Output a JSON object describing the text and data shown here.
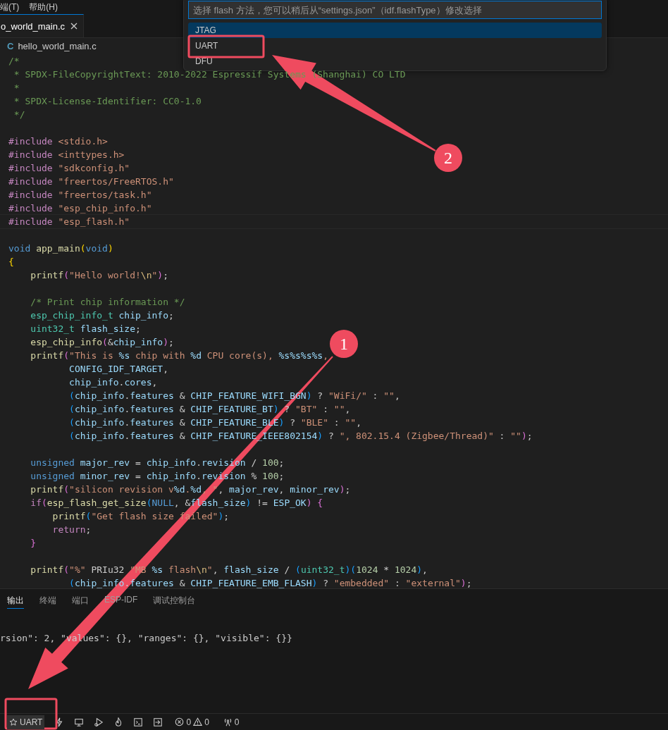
{
  "menu_bar": {
    "items": [
      "端(T)",
      "帮助(H)"
    ]
  },
  "editor_tabs": [
    {
      "label": "o_world_main.c",
      "selected": true
    }
  ],
  "breadcrumb": {
    "file_type": "C",
    "file": "hello_world_main.c"
  },
  "code": {
    "lines": [
      {
        "kind": "code",
        "tokens": [
          {
            "kind": "c",
            "text": "/*"
          }
        ]
      },
      {
        "kind": "code",
        "tokens": [
          {
            "kind": "c",
            "text": " * SPDX-FileCopyrightText: 2010-2022 Espressif Systems (Shanghai) CO LTD"
          }
        ]
      },
      {
        "kind": "code",
        "tokens": [
          {
            "kind": "c",
            "text": " *"
          }
        ]
      },
      {
        "kind": "code",
        "tokens": [
          {
            "kind": "c",
            "text": " * SPDX-License-Identifier: CC0-1.0"
          }
        ]
      },
      {
        "kind": "code",
        "tokens": [
          {
            "kind": "c",
            "text": " */"
          }
        ]
      },
      {
        "kind": "blank"
      },
      {
        "kind": "code",
        "tokens": [
          {
            "kind": "p",
            "text": "#include"
          },
          {
            "kind": "s",
            "text": " <stdio.h>"
          }
        ]
      },
      {
        "kind": "code",
        "tokens": [
          {
            "kind": "p",
            "text": "#include"
          },
          {
            "kind": "s",
            "text": " <inttypes.h>"
          }
        ]
      },
      {
        "kind": "code",
        "tokens": [
          {
            "kind": "p",
            "text": "#include"
          },
          {
            "kind": "s",
            "text": " \"sdkconfig.h\""
          }
        ]
      },
      {
        "kind": "code",
        "tokens": [
          {
            "kind": "p",
            "text": "#include"
          },
          {
            "kind": "s",
            "text": " \"freertos/FreeRTOS.h\""
          }
        ]
      },
      {
        "kind": "code",
        "tokens": [
          {
            "kind": "p",
            "text": "#include"
          },
          {
            "kind": "s",
            "text": " \"freertos/task.h\""
          }
        ]
      },
      {
        "kind": "code",
        "tokens": [
          {
            "kind": "p",
            "text": "#include"
          },
          {
            "kind": "s",
            "text": " \"esp_chip_info.h\""
          }
        ]
      },
      {
        "kind": "code",
        "current": true,
        "tokens": [
          {
            "kind": "p",
            "text": "#include"
          },
          {
            "kind": "s",
            "text": " \"esp_flash.h\""
          }
        ]
      },
      {
        "kind": "blank"
      },
      {
        "kind": "code",
        "tokens": [
          {
            "kind": "k",
            "text": "void"
          },
          {
            "kind": "f",
            "text": " app_main"
          },
          {
            "kind": "b1",
            "text": "("
          },
          {
            "kind": "k",
            "text": "void"
          },
          {
            "kind": "b1",
            "text": ")"
          }
        ]
      },
      {
        "kind": "code",
        "tokens": [
          {
            "kind": "b1",
            "text": "{"
          }
        ]
      },
      {
        "kind": "code",
        "tokens": [
          {
            "kind": "f",
            "text": "    printf"
          },
          {
            "kind": "b2",
            "text": "("
          },
          {
            "kind": "s",
            "text": "\"Hello world!"
          },
          {
            "kind": "e",
            "text": "\\n"
          },
          {
            "kind": "s",
            "text": "\""
          },
          {
            "kind": "b2",
            "text": ")"
          },
          {
            "kind": "x",
            "text": ";"
          }
        ]
      },
      {
        "kind": "blank"
      },
      {
        "kind": "code",
        "tokens": [
          {
            "kind": "c",
            "text": "    /* Print chip information */"
          }
        ]
      },
      {
        "kind": "code",
        "tokens": [
          {
            "kind": "t",
            "text": "    esp_chip_info_t"
          },
          {
            "kind": "v",
            "text": " chip_info"
          },
          {
            "kind": "x",
            "text": ";"
          }
        ]
      },
      {
        "kind": "code",
        "tokens": [
          {
            "kind": "t",
            "text": "    uint32_t"
          },
          {
            "kind": "v",
            "text": " flash_size"
          },
          {
            "kind": "x",
            "text": ";"
          }
        ]
      },
      {
        "kind": "code",
        "tokens": [
          {
            "kind": "f",
            "text": "    esp_chip_info"
          },
          {
            "kind": "b2",
            "text": "("
          },
          {
            "kind": "x",
            "text": "&"
          },
          {
            "kind": "v",
            "text": "chip_info"
          },
          {
            "kind": "b2",
            "text": ")"
          },
          {
            "kind": "x",
            "text": ";"
          }
        ]
      },
      {
        "kind": "code",
        "tokens": [
          {
            "kind": "f",
            "text": "    printf"
          },
          {
            "kind": "b2",
            "text": "("
          },
          {
            "kind": "s",
            "text": "\"This is "
          },
          {
            "kind": "v",
            "text": "%s"
          },
          {
            "kind": "s",
            "text": " chip with "
          },
          {
            "kind": "v",
            "text": "%d"
          },
          {
            "kind": "s",
            "text": " CPU core(s), "
          },
          {
            "kind": "v",
            "text": "%s%s%s%s"
          },
          {
            "kind": "s",
            "text": ","
          }
        ]
      },
      {
        "kind": "code",
        "tokens": [
          {
            "kind": "v",
            "text": "           CONFIG_IDF_TARGET"
          },
          {
            "kind": "x",
            "text": ","
          }
        ]
      },
      {
        "kind": "code",
        "tokens": [
          {
            "kind": "v",
            "text": "           chip_info"
          },
          {
            "kind": "x",
            "text": "."
          },
          {
            "kind": "v",
            "text": "cores"
          },
          {
            "kind": "x",
            "text": ","
          }
        ]
      },
      {
        "kind": "code",
        "tokens": [
          {
            "kind": "b3",
            "text": "           ("
          },
          {
            "kind": "v",
            "text": "chip_info"
          },
          {
            "kind": "x",
            "text": "."
          },
          {
            "kind": "v",
            "text": "features"
          },
          {
            "kind": "x",
            "text": " & "
          },
          {
            "kind": "v",
            "text": "CHIP_FEATURE_WIFI_BGN"
          },
          {
            "kind": "b3",
            "text": ")"
          },
          {
            "kind": "x",
            "text": " ? "
          },
          {
            "kind": "s",
            "text": "\"WiFi/\""
          },
          {
            "kind": "x",
            "text": " : "
          },
          {
            "kind": "s",
            "text": "\"\""
          },
          {
            "kind": "x",
            "text": ","
          }
        ]
      },
      {
        "kind": "code",
        "tokens": [
          {
            "kind": "b3",
            "text": "           ("
          },
          {
            "kind": "v",
            "text": "chip_info"
          },
          {
            "kind": "x",
            "text": "."
          },
          {
            "kind": "v",
            "text": "features"
          },
          {
            "kind": "x",
            "text": " & "
          },
          {
            "kind": "v",
            "text": "CHIP_FEATURE_BT"
          },
          {
            "kind": "b3",
            "text": ")"
          },
          {
            "kind": "x",
            "text": " ? "
          },
          {
            "kind": "s",
            "text": "\"BT\""
          },
          {
            "kind": "x",
            "text": " : "
          },
          {
            "kind": "s",
            "text": "\"\""
          },
          {
            "kind": "x",
            "text": ","
          }
        ]
      },
      {
        "kind": "code",
        "tokens": [
          {
            "kind": "b3",
            "text": "           ("
          },
          {
            "kind": "v",
            "text": "chip_info"
          },
          {
            "kind": "x",
            "text": "."
          },
          {
            "kind": "v",
            "text": "features"
          },
          {
            "kind": "x",
            "text": " & "
          },
          {
            "kind": "v",
            "text": "CHIP_FEATURE_BLE"
          },
          {
            "kind": "b3",
            "text": ")"
          },
          {
            "kind": "x",
            "text": " ? "
          },
          {
            "kind": "s",
            "text": "\"BLE\""
          },
          {
            "kind": "x",
            "text": " : "
          },
          {
            "kind": "s",
            "text": "\"\""
          },
          {
            "kind": "x",
            "text": ","
          }
        ]
      },
      {
        "kind": "code",
        "tokens": [
          {
            "kind": "b3",
            "text": "           ("
          },
          {
            "kind": "v",
            "text": "chip_info"
          },
          {
            "kind": "x",
            "text": "."
          },
          {
            "kind": "v",
            "text": "features"
          },
          {
            "kind": "x",
            "text": " & "
          },
          {
            "kind": "v",
            "text": "CHIP_FEATURE_IEEE802154"
          },
          {
            "kind": "b3",
            "text": ")"
          },
          {
            "kind": "x",
            "text": " ? "
          },
          {
            "kind": "s",
            "text": "\", 802.15.4 (Zigbee/Thread)\""
          },
          {
            "kind": "x",
            "text": " : "
          },
          {
            "kind": "s",
            "text": "\"\""
          },
          {
            "kind": "b2",
            "text": ")"
          },
          {
            "kind": "x",
            "text": ";"
          }
        ]
      },
      {
        "kind": "blank"
      },
      {
        "kind": "code",
        "tokens": [
          {
            "kind": "k",
            "text": "    unsigned"
          },
          {
            "kind": "v",
            "text": " major_rev"
          },
          {
            "kind": "x",
            "text": " = "
          },
          {
            "kind": "v",
            "text": "chip_info"
          },
          {
            "kind": "x",
            "text": "."
          },
          {
            "kind": "v",
            "text": "revision"
          },
          {
            "kind": "x",
            "text": " / "
          },
          {
            "kind": "n",
            "text": "100"
          },
          {
            "kind": "x",
            "text": ";"
          }
        ]
      },
      {
        "kind": "code",
        "tokens": [
          {
            "kind": "k",
            "text": "    unsigned"
          },
          {
            "kind": "v",
            "text": " minor_rev"
          },
          {
            "kind": "x",
            "text": " = "
          },
          {
            "kind": "v",
            "text": "chip_info"
          },
          {
            "kind": "x",
            "text": "."
          },
          {
            "kind": "v",
            "text": "revision"
          },
          {
            "kind": "x",
            "text": " % "
          },
          {
            "kind": "n",
            "text": "100"
          },
          {
            "kind": "x",
            "text": ";"
          }
        ]
      },
      {
        "kind": "code",
        "tokens": [
          {
            "kind": "f",
            "text": "    printf"
          },
          {
            "kind": "b2",
            "text": "("
          },
          {
            "kind": "s",
            "text": "\"silicon revision v"
          },
          {
            "kind": "v",
            "text": "%d"
          },
          {
            "kind": "s",
            "text": "."
          },
          {
            "kind": "v",
            "text": "%d"
          },
          {
            "kind": "s",
            "text": ", \""
          },
          {
            "kind": "x",
            "text": ", "
          },
          {
            "kind": "v",
            "text": "major_rev"
          },
          {
            "kind": "x",
            "text": ", "
          },
          {
            "kind": "v",
            "text": "minor_rev"
          },
          {
            "kind": "b2",
            "text": ")"
          },
          {
            "kind": "x",
            "text": ";"
          }
        ]
      },
      {
        "kind": "code",
        "tokens": [
          {
            "kind": "p",
            "text": "    if"
          },
          {
            "kind": "b2",
            "text": "("
          },
          {
            "kind": "f",
            "text": "esp_flash_get_size"
          },
          {
            "kind": "b3",
            "text": "("
          },
          {
            "kind": "k",
            "text": "NULL"
          },
          {
            "kind": "x",
            "text": ", &"
          },
          {
            "kind": "v",
            "text": "flash_size"
          },
          {
            "kind": "b3",
            "text": ")"
          },
          {
            "kind": "x",
            "text": " != "
          },
          {
            "kind": "v",
            "text": "ESP_OK"
          },
          {
            "kind": "b2",
            "text": ")"
          },
          {
            "kind": "b2",
            "text": " {"
          }
        ]
      },
      {
        "kind": "code",
        "tokens": [
          {
            "kind": "f",
            "text": "        printf"
          },
          {
            "kind": "b3",
            "text": "("
          },
          {
            "kind": "s",
            "text": "\"Get flash size failed\""
          },
          {
            "kind": "b3",
            "text": ")"
          },
          {
            "kind": "x",
            "text": ";"
          }
        ]
      },
      {
        "kind": "code",
        "tokens": [
          {
            "kind": "p",
            "text": "        return"
          },
          {
            "kind": "x",
            "text": ";"
          }
        ]
      },
      {
        "kind": "code",
        "tokens": [
          {
            "kind": "b2",
            "text": "    }"
          }
        ]
      },
      {
        "kind": "blank"
      },
      {
        "kind": "code",
        "tokens": [
          {
            "kind": "f",
            "text": "    printf"
          },
          {
            "kind": "b2",
            "text": "("
          },
          {
            "kind": "s",
            "text": "\"%\""
          },
          {
            "kind": "x",
            "text": " PRIu32 "
          },
          {
            "kind": "s",
            "text": "\"MB "
          },
          {
            "kind": "v",
            "text": "%s"
          },
          {
            "kind": "s",
            "text": " flash"
          },
          {
            "kind": "e",
            "text": "\\n"
          },
          {
            "kind": "s",
            "text": "\""
          },
          {
            "kind": "x",
            "text": ", "
          },
          {
            "kind": "v",
            "text": "flash_size"
          },
          {
            "kind": "x",
            "text": " / "
          },
          {
            "kind": "b3",
            "text": "("
          },
          {
            "kind": "t",
            "text": "uint32_t"
          },
          {
            "kind": "b3",
            "text": ")("
          },
          {
            "kind": "n",
            "text": "1024"
          },
          {
            "kind": "x",
            "text": " * "
          },
          {
            "kind": "n",
            "text": "1024"
          },
          {
            "kind": "b3",
            "text": ")"
          },
          {
            "kind": "x",
            "text": ","
          }
        ]
      },
      {
        "kind": "code",
        "tokens": [
          {
            "kind": "b3",
            "text": "           ("
          },
          {
            "kind": "v",
            "text": "chip_info"
          },
          {
            "kind": "x",
            "text": "."
          },
          {
            "kind": "v",
            "text": "features"
          },
          {
            "kind": "x",
            "text": " & "
          },
          {
            "kind": "v",
            "text": "CHIP_FEATURE_EMB_FLASH"
          },
          {
            "kind": "b3",
            "text": ")"
          },
          {
            "kind": "x",
            "text": " ? "
          },
          {
            "kind": "s",
            "text": "\"embedded\""
          },
          {
            "kind": "x",
            "text": " : "
          },
          {
            "kind": "s",
            "text": "\"external\""
          },
          {
            "kind": "b2",
            "text": ")"
          },
          {
            "kind": "x",
            "text": ";"
          }
        ]
      }
    ]
  },
  "quick_pick": {
    "placeholder": "选择 flash 方法，您可以稍后从“settings.json”（idf.flashType）修改选择",
    "items": [
      {
        "label": "JTAG",
        "selected": true
      },
      {
        "label": "UART",
        "selected": false
      },
      {
        "label": "DFU",
        "selected": false
      }
    ]
  },
  "panel": {
    "tabs": [
      {
        "label": "输出",
        "selected": true
      },
      {
        "label": "终端",
        "selected": false
      },
      {
        "label": "端口",
        "selected": false
      },
      {
        "label": "ESP-IDF",
        "selected": false
      },
      {
        "label": "调试控制台",
        "selected": false
      }
    ],
    "output": "rsion\": 2, \"values\": {}, \"ranges\": {}, \"visible\": {}}"
  },
  "status_bar": {
    "flash_method": "UART",
    "errors": "0",
    "warnings": "0",
    "ports": "0"
  },
  "annotations": [
    {
      "label": "1"
    },
    {
      "label": "2"
    }
  ]
}
